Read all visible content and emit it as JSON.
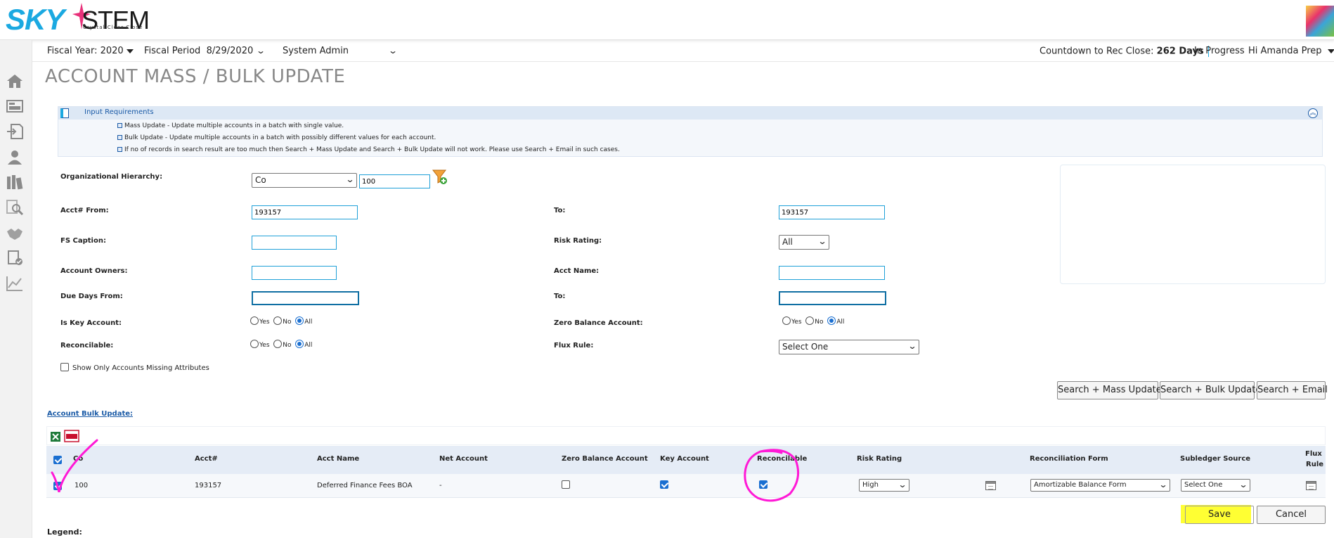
{
  "brand": {
    "sky": "SKY",
    "stem": "STEM",
    "tagline": "Crystal Clear Close"
  },
  "nav": {
    "fiscal_year": "Fiscal Year: 2020",
    "fiscal_period_label": "Fiscal Period",
    "fiscal_period_value": "8/29/2020",
    "role": "System Admin",
    "countdown_label": "Countdown to Rec Close:",
    "countdown_value": "262 Days",
    "status": "In Progress",
    "greeting": "Hi Amanda Prep"
  },
  "page_title": "ACCOUNT MASS / BULK UPDATE",
  "requirements": {
    "title": "Input Requirements",
    "lines": [
      "Mass Update - Update multiple accounts in a batch with single value.",
      "Bulk Update - Update multiple accounts in a batch with possibly different values for each account.",
      "If no of records in search result are too much then Search + Mass Update and Search + Bulk Update will not work. Please use Search + Email in such cases."
    ]
  },
  "form": {
    "org_label": "Organizational Hierarchy:",
    "org_select": "Co",
    "org_value": "100",
    "acct_from_label": "Acct# From:",
    "acct_from_value": "193157",
    "to_label": "To:",
    "acct_to_value": "193157",
    "fs_caption_label": "FS Caption:",
    "fs_caption_value": "",
    "risk_rating_label": "Risk Rating:",
    "risk_rating_value": "All",
    "owners_label": "Account Owners:",
    "owners_value": "",
    "acct_name_label": "Acct Name:",
    "acct_name_value": "",
    "due_days_label": "Due Days From:",
    "due_days_value": "",
    "due_to_label": "To:",
    "due_to_value": "",
    "key_account_label": "Is Key Account:",
    "zero_balance_label": "Zero Balance Account:",
    "reconcilable_label": "Reconcilable:",
    "flux_rule_label": "Flux Rule:",
    "flux_rule_value": "Select One",
    "radio_yes": "Yes",
    "radio_no": "No",
    "radio_all": "All",
    "missing_attr_label": "Show Only Accounts Missing Attributes",
    "btn_mass": "Search + Mass Update",
    "btn_bulk": "Search + Bulk Update",
    "btn_email": "Search + Email"
  },
  "grid": {
    "title": "Account Bulk Update:",
    "columns": [
      "Co",
      "Acct#",
      "Acct Name",
      "Net Account",
      "Zero Balance Account",
      "Key Account",
      "Reconcilable",
      "Risk Rating",
      "Reconciliation Form",
      "Subledger Source",
      "Flux",
      "Rule"
    ],
    "row": {
      "co": "100",
      "acct": "193157",
      "acct_name": "Deferred Finance Fees BOA",
      "net_account": "-",
      "risk_rating": "High",
      "rec_form": "Amortizable Balance Form",
      "subledger": "Select One"
    }
  },
  "actions": {
    "save": "Save",
    "cancel": "Cancel"
  },
  "legend": "Legend:",
  "colors": {
    "accent": "#1ba9e1",
    "annotation": "#ff19d6",
    "highlight": "#ffff33"
  }
}
